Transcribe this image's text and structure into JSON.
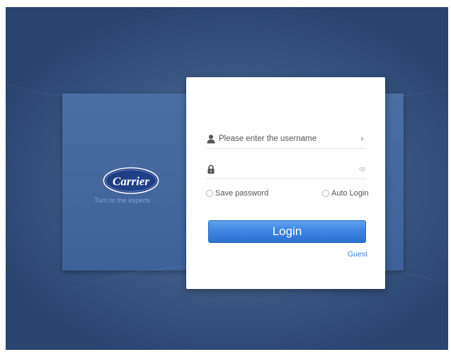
{
  "brand": {
    "logo_text": "Carrier",
    "tagline": "Turn to the experts"
  },
  "login": {
    "username_placeholder": "Please enter the username",
    "password_value": "",
    "save_password_label": "Save password",
    "auto_login_label": "Auto Login",
    "login_button_label": "Login",
    "guest_link_label": "Guest"
  },
  "icons": {
    "username": "user-icon",
    "password": "lock-icon",
    "username_trailing": "arrow-right-icon",
    "password_trailing": "eye-icon"
  },
  "colors": {
    "background": "#3a5683",
    "brand_panel": "#4468a0",
    "login_button": "#3e86e0",
    "link": "#3b82d8",
    "logo": "#1f3f86"
  }
}
